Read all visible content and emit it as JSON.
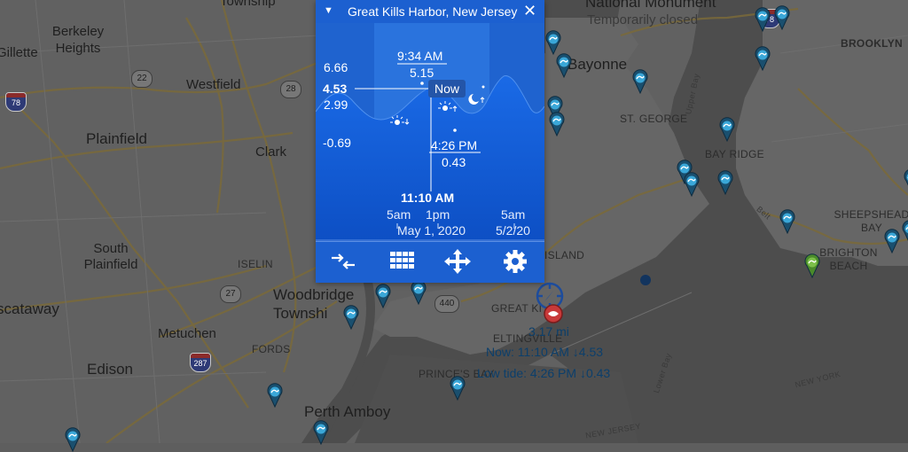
{
  "station": {
    "title": "Great Kills Harbor, New Jersey"
  },
  "chart": {
    "y_labels": [
      "6.66",
      "4.53",
      "2.99",
      "-0.69"
    ],
    "high_tide": {
      "time": "9:34 AM",
      "height": "5.15"
    },
    "low_tide": {
      "time": "4:26 PM",
      "height": "0.43"
    },
    "now_label": "Now",
    "current_time": "11:10 AM",
    "x_labels": [
      "5am",
      "1pm",
      "5am"
    ],
    "dates": [
      "May 1, 2020",
      "5/2/20"
    ],
    "colors": {
      "water": "#1b63d8",
      "panel_bg": "#1c60d0",
      "header": "#1c60d0"
    }
  },
  "toolbar": {
    "items": [
      "compare-icon",
      "grid-icon",
      "move-icon",
      "settings-icon"
    ]
  },
  "map": {
    "places": [
      {
        "name": "Township",
        "cls": "lbl"
      },
      {
        "name": "Berkeley Heights",
        "cls": "lbl"
      },
      {
        "name": "Gillette",
        "cls": "lbl"
      },
      {
        "name": "Westfield",
        "cls": "lbl"
      },
      {
        "name": "Plainfield",
        "cls": "lbl lg"
      },
      {
        "name": "Clark",
        "cls": "lbl"
      },
      {
        "name": "South Plainfield",
        "cls": "lbl"
      },
      {
        "name": "Iselin",
        "cls": "lbl sm"
      },
      {
        "name": "Woodbridge Townshi",
        "cls": "lbl lg"
      },
      {
        "name": "scataway",
        "cls": "lbl lg"
      },
      {
        "name": "Metuchen",
        "cls": "lbl"
      },
      {
        "name": "Fords",
        "cls": "lbl sm"
      },
      {
        "name": "Edison",
        "cls": "lbl lg"
      },
      {
        "name": "Perth Amboy",
        "cls": "lbl lg"
      },
      {
        "name": "Bayonne",
        "cls": "lbl lg"
      },
      {
        "name": "St. George",
        "cls": "lbl sm"
      },
      {
        "name": "Bay Ridge",
        "cls": "lbl sm"
      },
      {
        "name": "Brooklyn",
        "cls": "lbl sm"
      },
      {
        "name": "Sheepshead Bay",
        "cls": "lbl sm"
      },
      {
        "name": "Brighton Beach",
        "cls": "lbl sm"
      },
      {
        "name": "Great Ki",
        "cls": "lbl sm"
      },
      {
        "name": "Eltingville",
        "cls": "lbl sm"
      },
      {
        "name": "Prince's Bay",
        "cls": "lbl sm"
      },
      {
        "name": "Island",
        "cls": "lbl sm"
      },
      {
        "name": "National Monument",
        "cls": "lbl lg"
      },
      {
        "name": "Temporarily closed",
        "cls": "lbl dim"
      },
      {
        "name": "Upper Bay",
        "cls": "lbl road"
      },
      {
        "name": "Lower Bay",
        "cls": "lbl road"
      },
      {
        "name": "New Jersey",
        "cls": "lbl road"
      },
      {
        "name": "New York",
        "cls": "lbl road"
      },
      {
        "name": "Belt",
        "cls": "lbl road"
      }
    ],
    "shields": [
      "22",
      "28",
      "27",
      "440"
    ],
    "interstates": [
      "78",
      "287",
      "78"
    ],
    "readout": {
      "distance": "3.17 mi",
      "now": "Now: 11:10 AM ↓4.53",
      "low_tide": "Low tide: 4:26 PM ↓0.43"
    }
  }
}
